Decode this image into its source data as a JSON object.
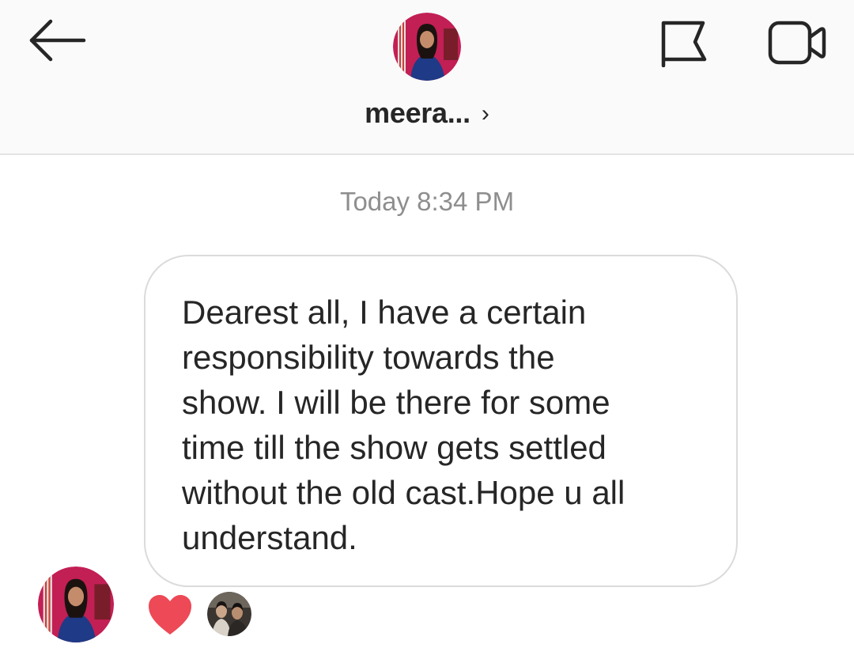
{
  "header": {
    "username": "meera...",
    "chevron": "›",
    "back_icon": "arrow-left-icon",
    "flag_icon": "flag-icon",
    "video_icon": "video-camera-icon",
    "avatar": "profile-photo-avatar"
  },
  "thread": {
    "timestamp": "Today 8:34 PM",
    "message": "Dearest all, I have a certain\nresponsibility towards the\nshow. I will be there for some\ntime till the show gets settled\nwithout the old cast.Hope u all\nunderstand.",
    "reaction_icon": "heart-icon",
    "reaction_color": "#ed4956",
    "reactor_avatar": "reactor-photo-avatar"
  },
  "colors": {
    "header_bg": "#fafafa",
    "text": "#262626",
    "muted_text": "#8e8e8e",
    "bubble_border": "#dbdbdb",
    "heart": "#ed4956"
  }
}
